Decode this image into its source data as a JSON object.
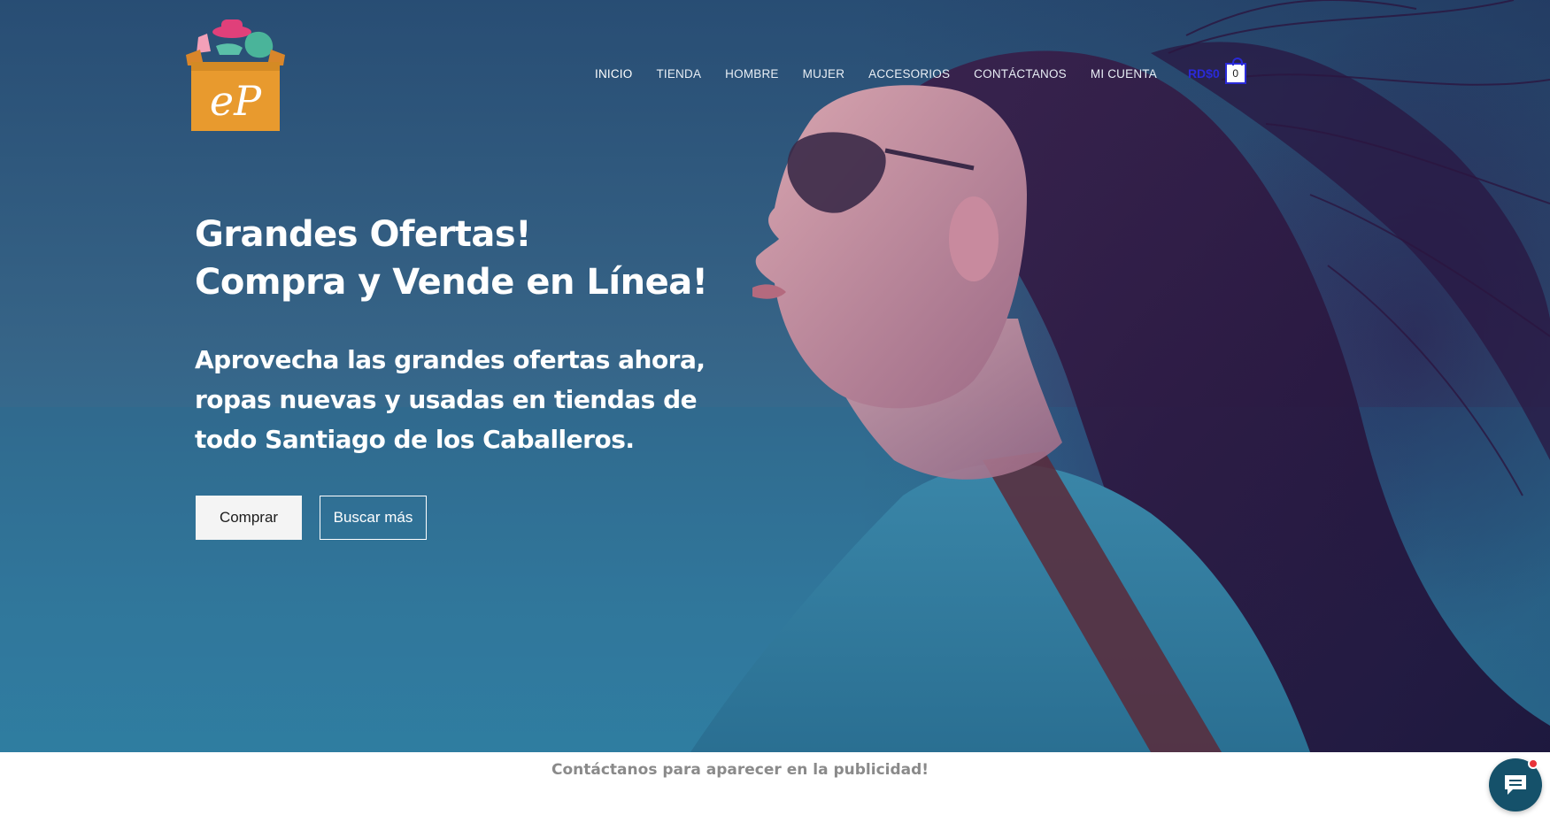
{
  "header": {
    "logo_text": "eP",
    "nav": [
      {
        "label": "INICIO",
        "active": true
      },
      {
        "label": "TIENDA"
      },
      {
        "label": "HOMBRE"
      },
      {
        "label": "MUJER"
      },
      {
        "label": "ACCESORIOS"
      },
      {
        "label": "CONTÁCTANOS"
      },
      {
        "label": "MI CUENTA"
      }
    ],
    "cart": {
      "total": "RD$0",
      "count": "0"
    }
  },
  "hero": {
    "headline_line1": "Grandes Ofertas!",
    "headline_line2": "Compra y Vende en Línea!",
    "subtext": "Aprovecha las grandes ofertas ahora, ropas nuevas y usadas en tiendas de todo Santiago de los Caballeros.",
    "primary_button": "Comprar",
    "secondary_button": "Buscar más"
  },
  "promo": {
    "text": "Contáctanos para aparecer en la publicidad!"
  },
  "chat": {
    "icon": "chat-bubble-icon"
  },
  "colors": {
    "hero_overlay": "#1f5a86",
    "cart_accent": "#2a2ad8",
    "logo_box": "#e89a2e",
    "chat_button": "#15516a",
    "notification_dot": "#e8333a"
  }
}
